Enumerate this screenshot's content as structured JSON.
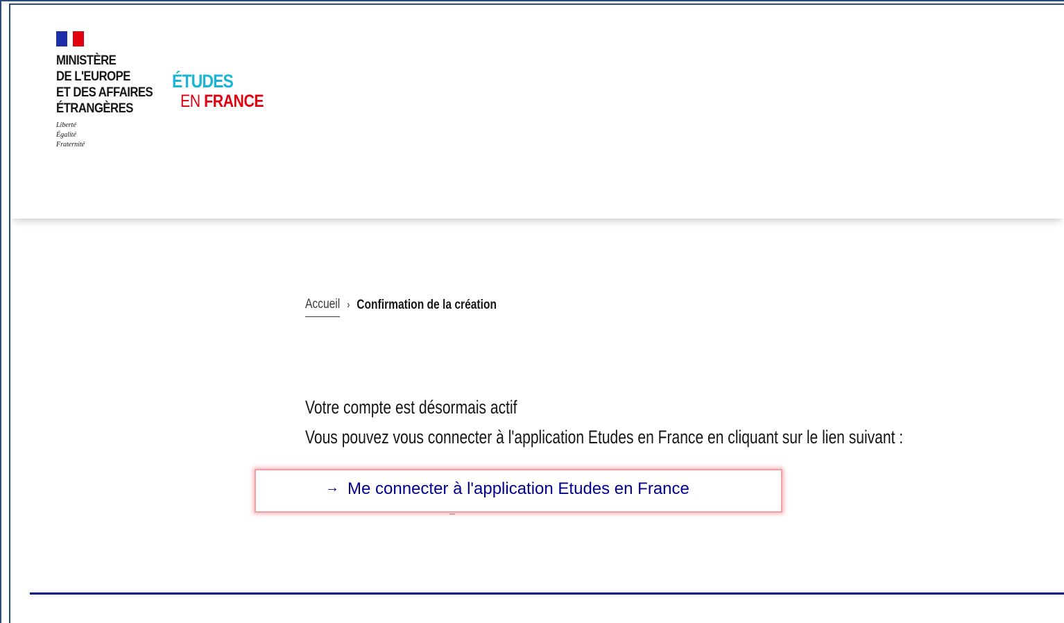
{
  "header": {
    "ministry_lines": [
      "MINISTÈRE",
      "DE L'EUROPE",
      "ET DES AFFAIRES",
      "ÉTRANGÈRES"
    ],
    "motto_lines": [
      "Liberté",
      "Égalité",
      "Fraternité"
    ],
    "brand_top": "ÉTUDES",
    "brand_en": "EN",
    "brand_fr": "FRANCE"
  },
  "breadcrumb": {
    "home": "Accueil",
    "current": "Confirmation de la création"
  },
  "main": {
    "status_message": "Votre compte est désormais actif",
    "instruction": "Vous pouvez vous connecter à l'application Etudes en France en cliquant sur le lien suivant :",
    "connect_link_arrow": "→",
    "connect_link_label": "Me connecter à l'application Etudes en France"
  },
  "colors": {
    "marianne_blue": "#1b2fa8",
    "marianne_red": "#e1000f",
    "brand_cyan": "#19b4d8",
    "link_blue": "#000091",
    "highlight": "#f2a0a8"
  }
}
